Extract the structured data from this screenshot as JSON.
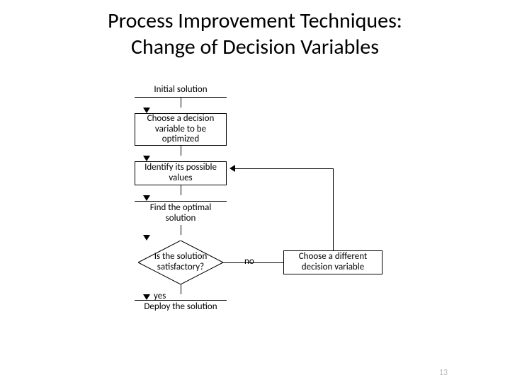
{
  "title_line1": "Process Improvement Techniques:",
  "title_line2": "Change of Decision Variables",
  "nodes": {
    "initial": "Initial solution",
    "choose": "Choose a decision variable to be optimized",
    "identify": "Identify its possible values",
    "find": "Find the optimal solution",
    "satisfactory": "Is the solution satisfactory?",
    "deploy": "Deploy the solution",
    "choose_diff": "Choose a different decision variable"
  },
  "labels": {
    "yes": "yes",
    "no": "no"
  },
  "page_number": "13"
}
